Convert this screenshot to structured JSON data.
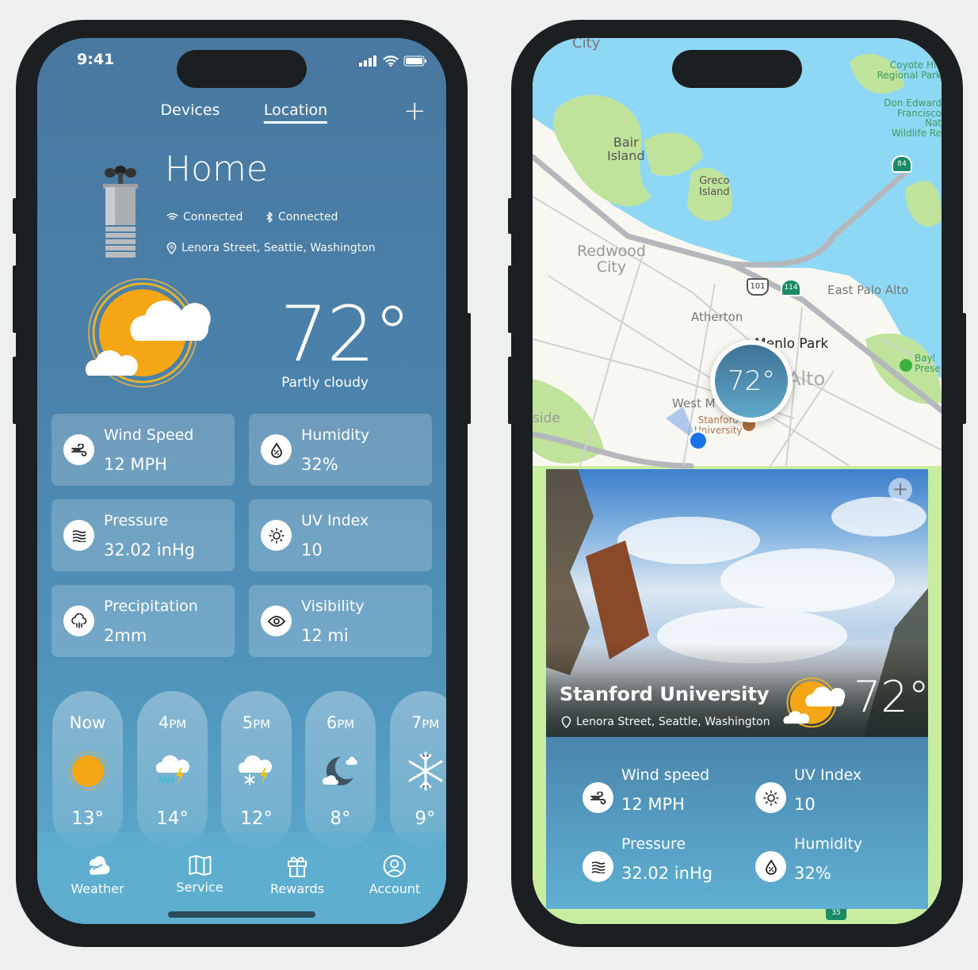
{
  "phone1": {
    "status": {
      "time": "9:41"
    },
    "tabs": [
      {
        "label": "Devices",
        "active": false
      },
      {
        "label": "Location",
        "active": true
      }
    ],
    "add_icon": "plus-icon",
    "location": {
      "name": "Home",
      "wifi_status": "Connected",
      "bluetooth_status": "Connected",
      "address": "Lenora Street, Seattle, Washington"
    },
    "current": {
      "temperature": "72°",
      "condition": "Partly cloudy",
      "icon": "partly-cloudy-icon"
    },
    "metrics": [
      {
        "label": "Wind Speed",
        "value": "12 MPH",
        "icon": "wind-icon"
      },
      {
        "label": "Humidity",
        "value": "32%",
        "icon": "humidity-icon"
      },
      {
        "label": "Pressure",
        "value": "32.02 inHg",
        "icon": "pressure-icon"
      },
      {
        "label": "UV Index",
        "value": "10",
        "icon": "uv-icon"
      },
      {
        "label": "Precipitation",
        "value": "2mm",
        "icon": "precipitation-icon"
      },
      {
        "label": "Visibility",
        "value": "12 mi",
        "icon": "eye-icon"
      }
    ],
    "hourly": [
      {
        "hour": "Now",
        "suffix": "",
        "temp": "13°",
        "icon": "sun-icon"
      },
      {
        "hour": "4",
        "suffix": "PM",
        "temp": "14°",
        "icon": "thunder-rain-icon"
      },
      {
        "hour": "5",
        "suffix": "PM",
        "temp": "12°",
        "icon": "thunder-snow-icon"
      },
      {
        "hour": "6",
        "suffix": "PM",
        "temp": "8°",
        "icon": "moon-cloud-icon"
      },
      {
        "hour": "7",
        "suffix": "PM",
        "temp": "9°",
        "icon": "snowflake-icon"
      }
    ],
    "nav": [
      {
        "label": "Weather",
        "icon": "weather-icon",
        "active": true
      },
      {
        "label": "Service",
        "icon": "map-icon"
      },
      {
        "label": "Rewards",
        "icon": "gift-icon"
      },
      {
        "label": "Account",
        "icon": "account-icon"
      }
    ]
  },
  "phone2": {
    "map_labels": {
      "city_top": "City",
      "bair": "Bair\nIsland",
      "greco": "Greco\nIsland",
      "redwood": "Redwood\nCity",
      "atherton": "Atherton",
      "menlo": "Menlo Park",
      "palo": "Alto",
      "east_palo": "East Palo Alto",
      "west": "West M",
      "stanford": "Stanford\nUniversity",
      "side": "side",
      "coyote": "Coyote Hill\nRegional Park",
      "don": "Don Edward\nFrancisco\nNat\nWildlife Re",
      "baylands": "Bayl\nPrese",
      "hwy101": "101",
      "hwy114": "114",
      "hwy84": "84",
      "hwy35": "35"
    },
    "map_temperature": "72°",
    "colors": {
      "water": "#8fd8f5",
      "park": "#bfe39a",
      "land": "#f8f7f2",
      "location_dot": "#1a73e8"
    },
    "card": {
      "title": "Stanford University",
      "address": "Lenora Street, Seattle, Washington",
      "temperature": "72°",
      "metrics": [
        {
          "label": "Wind speed",
          "value": "12 MPH",
          "icon": "wind-icon"
        },
        {
          "label": "UV Index",
          "value": "10",
          "icon": "uv-icon"
        },
        {
          "label": "Pressure",
          "value": "32.02 inHg",
          "icon": "pressure-icon"
        },
        {
          "label": "Humidity",
          "value": "32%",
          "icon": "humidity-icon"
        }
      ]
    }
  }
}
